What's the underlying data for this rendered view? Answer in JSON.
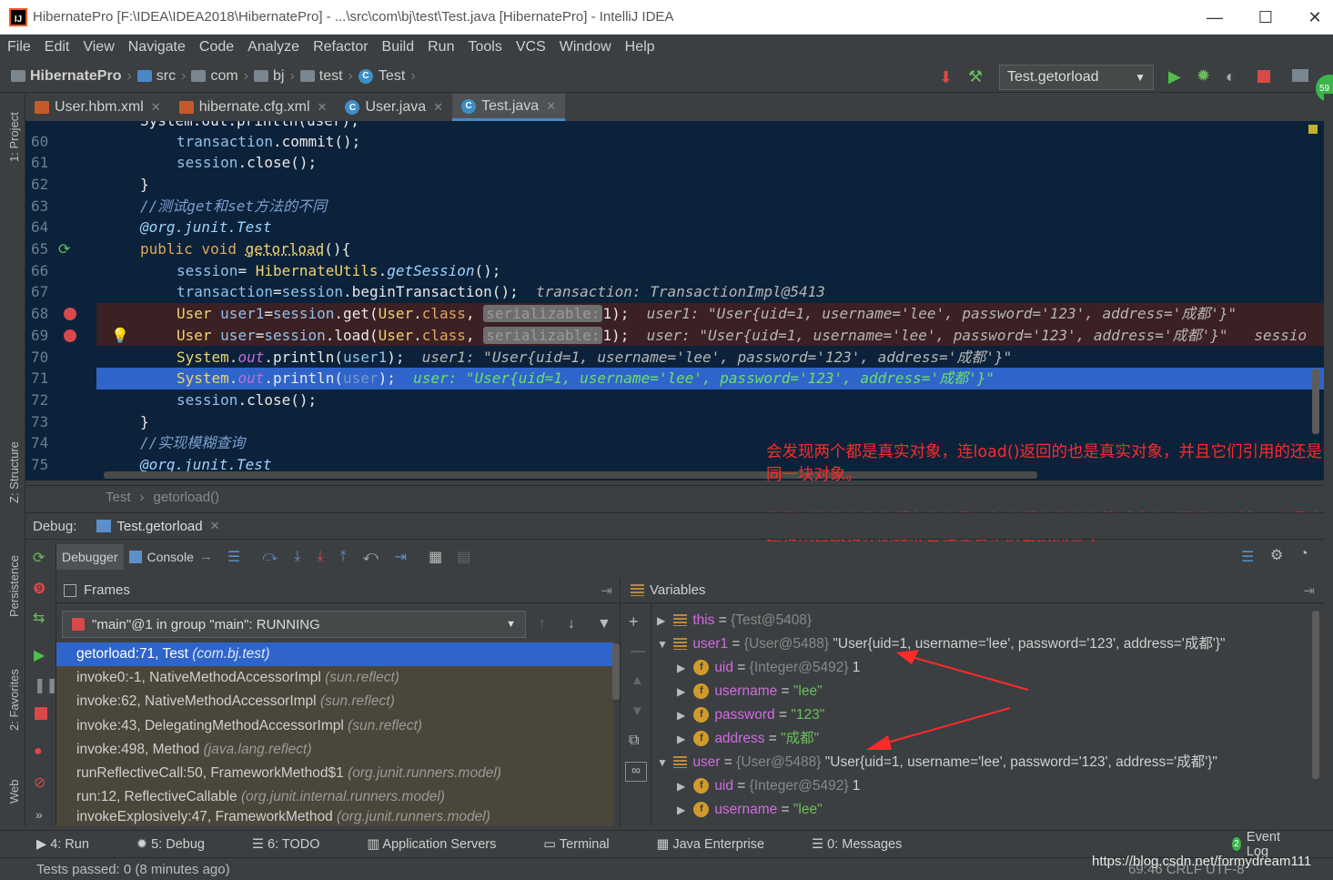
{
  "window": {
    "title": "HibernatePro [F:\\IDEA\\IDEA2018\\HibernatePro] - ...\\src\\com\\bj\\test\\Test.java [HibernatePro] - IntelliJ IDEA"
  },
  "menu": [
    "File",
    "Edit",
    "View",
    "Navigate",
    "Code",
    "Analyze",
    "Refactor",
    "Build",
    "Run",
    "Tools",
    "VCS",
    "Window",
    "Help"
  ],
  "breadcrumb": [
    "HibernatePro",
    "src",
    "com",
    "bj",
    "test",
    "Test"
  ],
  "run_config": "Test.getorload",
  "tabs": [
    {
      "label": "User.hbm.xml"
    },
    {
      "label": "hibernate.cfg.xml"
    },
    {
      "label": "User.java"
    },
    {
      "label": "Test.java"
    }
  ],
  "side_tools": {
    "project": "1: Project",
    "structure": "Z: Structure",
    "persistence": "Persistence",
    "favorites": "2: Favorites",
    "web": "Web"
  },
  "editor": {
    "lines": [
      "60",
      "61",
      "62",
      "63",
      "64",
      "65",
      "66",
      "67",
      "68",
      "69",
      "70",
      "71",
      "72",
      "73",
      "74",
      "75"
    ],
    "l59": "System.out.println(user);",
    "l60": "transaction.commit();",
    "l61": "session.close();",
    "l62": "}",
    "l63": "//测试get和set方法的不同",
    "l64": "@org.junit.Test",
    "l65a": "public void ",
    "l65b": "getorload",
    "l65c": "(){",
    "l66": "session= HibernateUtils.getSession();",
    "l67": "transaction=session.beginTransaction();",
    "l67d": "transaction: TransactionImpl@5413",
    "l68": "User user1=session.get(User.class, ",
    "l68b": "serializable:",
    "l68c": "1);",
    "l68d": "user1: \"User{uid=1, username='lee', password='123', address='成都'}\"",
    "l69": "User user=session.load(User.class, ",
    "l69d": "user: \"User{uid=1, username='lee', password='123', address='成都'}\"   sessio",
    "l70": "System.out.println(user1);",
    "l70d": "user1: \"User{uid=1, username='lee', password='123', address='成都'}\"",
    "l71": "System.out.println(user);",
    "l71d": "user: \"User{uid=1, username='lee', password='123', address='成都'}\"",
    "l72": "session.close();",
    "l73": "}",
    "l74": "//实现模糊查询",
    "l75": "@org.junit.Test"
  },
  "annotation": {
    "text": "会发现两个都是真实对象，连load()返回的也是真实对象，并且它们引用的还是同一块对象。\n这个是因为get()查询出来ID为1的对象后会将其放入到缓存中，而load()再去查询的时候它会先去缓存中查找，如果缓存中没有的话才会返回代理对象，但是当缓存中已经存在的话就直接将真实对象返回来了。"
  },
  "editor_crumb": [
    "Test",
    "getorload()"
  ],
  "debug": {
    "label": "Debug:",
    "session": "Test.getorload",
    "tab_debugger": "Debugger",
    "tab_console": "Console",
    "frames_title": "Frames",
    "variables_title": "Variables",
    "thread": "\"main\"@1 in group \"main\": RUNNING",
    "frames": [
      {
        "m": "getorload:71, Test ",
        "p": "(com.bj.test)"
      },
      {
        "m": "invoke0:-1, NativeMethodAccessorImpl ",
        "p": "(sun.reflect)"
      },
      {
        "m": "invoke:62, NativeMethodAccessorImpl ",
        "p": "(sun.reflect)"
      },
      {
        "m": "invoke:43, DelegatingMethodAccessorImpl ",
        "p": "(sun.reflect)"
      },
      {
        "m": "invoke:498, Method ",
        "p": "(java.lang.reflect)"
      },
      {
        "m": "runReflectiveCall:50, FrameworkMethod$1 ",
        "p": "(org.junit.runners.model)"
      },
      {
        "m": "run:12, ReflectiveCallable ",
        "p": "(org.junit.internal.runners.model)"
      },
      {
        "m": "invokeExplosively:47, FrameworkMethod ",
        "p": "(org.junit.runners.model)"
      }
    ],
    "vars": {
      "this_name": "this",
      "this_eq": " = ",
      "this_type": "{Test@5408}",
      "user1_name": "user1",
      "user1_type": "{User@5488}",
      "user1_val": " \"User{uid=1, username='lee', password='123', address='成都'}\"",
      "uid_name": "uid",
      "uid_type": "{Integer@5492}",
      "uid_val": " 1",
      "username_name": "username",
      "username_val": "\"lee\"",
      "password_name": "password",
      "password_val": "\"123\"",
      "address_name": "address",
      "address_val": "\"成都\"",
      "user_name": "user",
      "user_type": "{User@5488}",
      "user_val": " \"User{uid=1, username='lee', password='123', address='成都'}\"",
      "uid2_name": "uid",
      "uid2_type": "{Integer@5492}",
      "uid2_val": " 1",
      "username2_name": "username",
      "username2_val": "\"lee\""
    }
  },
  "bottom_tools": [
    "4: Run",
    "5: Debug",
    "6: TODO",
    "Application Servers",
    "Terminal",
    "Java Enterprise",
    "0: Messages"
  ],
  "event_log": "Event Log",
  "event_count": "2",
  "status": "Tests passed: 0 (8 minutes ago)",
  "status_right": "69:46   CRLF   UTF-8",
  "watermark": "https://blog.csdn.net/formydream111",
  "colors": {
    "accent": "#2f65ca",
    "editor_bg": "#0c223a",
    "annotation": "#ff2a2a"
  }
}
